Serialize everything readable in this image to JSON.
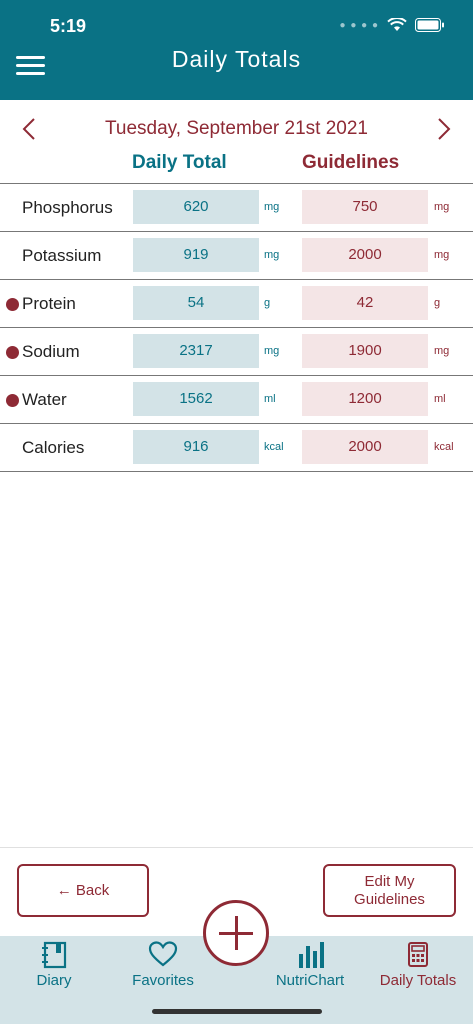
{
  "status_bar": {
    "time": "5:19"
  },
  "header": {
    "title": "Daily Totals"
  },
  "date_nav": {
    "date": "Tuesday, September 21st 2021"
  },
  "columns": {
    "daily_total": "Daily Total",
    "guidelines": "Guidelines"
  },
  "rows": [
    {
      "name": "Phosphorus",
      "flag": false,
      "daily": "620",
      "daily_unit": "mg",
      "guide": "750",
      "guide_unit": "mg"
    },
    {
      "name": "Potassium",
      "flag": false,
      "daily": "919",
      "daily_unit": "mg",
      "guide": "2000",
      "guide_unit": "mg"
    },
    {
      "name": "Protein",
      "flag": true,
      "daily": "54",
      "daily_unit": "g",
      "guide": "42",
      "guide_unit": "g"
    },
    {
      "name": "Sodium",
      "flag": true,
      "daily": "2317",
      "daily_unit": "mg",
      "guide": "1900",
      "guide_unit": "mg"
    },
    {
      "name": "Water",
      "flag": true,
      "daily": "1562",
      "daily_unit": "ml",
      "guide": "1200",
      "guide_unit": "ml"
    },
    {
      "name": "Calories",
      "flag": false,
      "daily": "916",
      "daily_unit": "kcal",
      "guide": "2000",
      "guide_unit": "kcal"
    }
  ],
  "buttons": {
    "back": "← Back",
    "edit_line1": "Edit My",
    "edit_line2": "Guidelines"
  },
  "tabs": [
    {
      "label": "Diary",
      "icon": "notebook-icon",
      "color": "#0a7285"
    },
    {
      "label": "Favorites",
      "icon": "heart-icon",
      "color": "#0a7285"
    },
    {
      "label": "NutriChart",
      "icon": "bar-chart-icon",
      "color": "#0a7285"
    },
    {
      "label": "Daily Totals",
      "icon": "calculator-icon",
      "color": "#8e2a35"
    }
  ],
  "colors": {
    "teal": "#0a7285",
    "maroon": "#8e2a35",
    "teal_light": "#d3e3e7",
    "rose_light": "#f4e5e6"
  }
}
